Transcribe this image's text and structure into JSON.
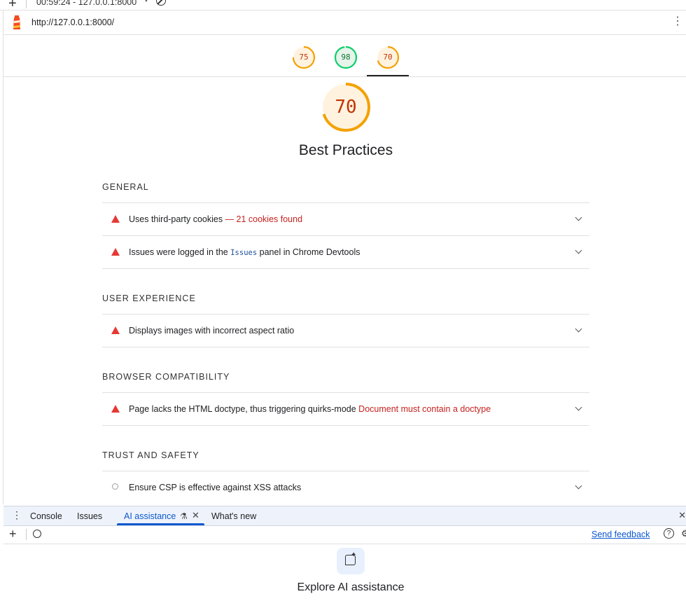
{
  "toolbar": {
    "run_label": "00:59:24 - 127.0.0.1:8000"
  },
  "report": {
    "url": "http://127.0.0.1:8000/",
    "gauges": [
      {
        "score": "75",
        "value": 75,
        "color": "#f4a100",
        "fill": "#fff3e0",
        "text": "#c33300"
      },
      {
        "score": "98",
        "value": 98,
        "color": "#0cce6b",
        "fill": "#e6f4ea",
        "text": "#137333"
      },
      {
        "score": "70",
        "value": 70,
        "color": "#f4a100",
        "fill": "#fff3e0",
        "text": "#c33300"
      }
    ],
    "category": {
      "score": "70",
      "value": 70,
      "title": "Best Practices"
    },
    "sections": [
      {
        "title": "GENERAL"
      },
      {
        "title": "USER EXPERIENCE"
      },
      {
        "title": "BROWSER COMPATIBILITY"
      },
      {
        "title": "TRUST AND SAFETY"
      }
    ],
    "audits": {
      "cookies": {
        "text": "Uses third-party cookies",
        "fail": " — 21 cookies found"
      },
      "issues": {
        "pre": "Issues were logged in the ",
        "code": "Issues",
        "post": " panel in Chrome Devtools"
      },
      "aspect": {
        "text": "Displays images with incorrect aspect ratio"
      },
      "doctype": {
        "text": "Page lacks the HTML doctype, thus triggering quirks-mode",
        "fail": " Document must contain a doctype"
      },
      "csp": {
        "text": "Ensure CSP is effective against XSS attacks"
      }
    }
  },
  "drawer": {
    "tabs": [
      "Console",
      "Issues",
      "AI assistance",
      "What's new"
    ],
    "send_feedback": "Send feedback",
    "ai_title": "Explore AI assistance"
  }
}
